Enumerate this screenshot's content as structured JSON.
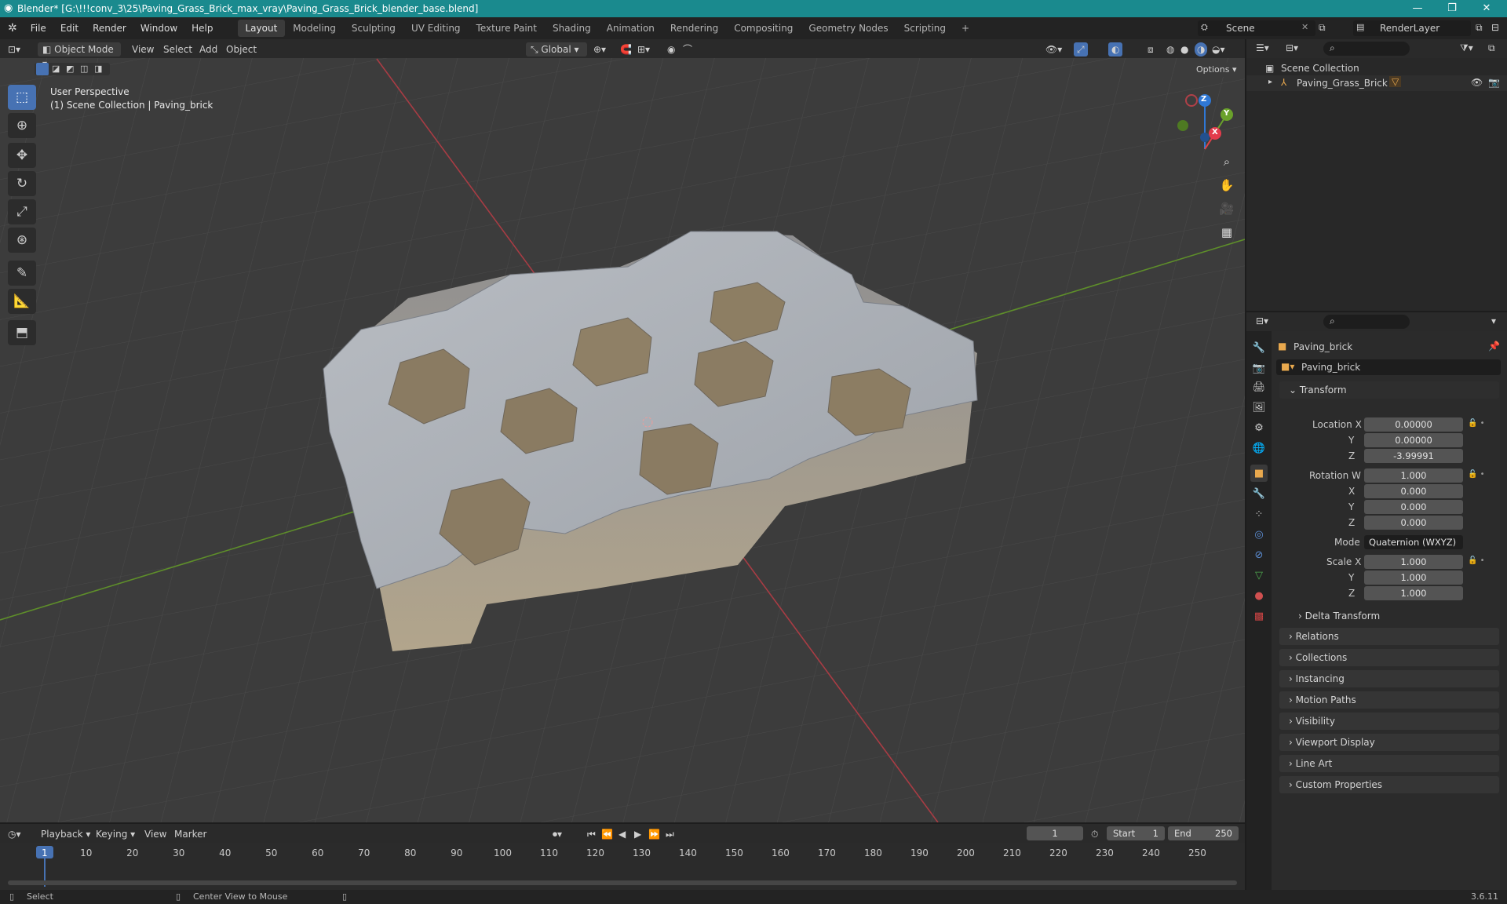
{
  "window": {
    "title": "Blender* [G:\\!!!conv_3\\25\\Paving_Grass_Brick_max_vray\\Paving_Grass_Brick_blender_base.blend]",
    "minimize": "—",
    "maximize": "❐",
    "close": "✕"
  },
  "menu": [
    "File",
    "Edit",
    "Render",
    "Window",
    "Help"
  ],
  "workspaces": [
    "Layout",
    "Modeling",
    "Sculpting",
    "UV Editing",
    "Texture Paint",
    "Shading",
    "Animation",
    "Rendering",
    "Compositing",
    "Geometry Nodes",
    "Scripting",
    "+"
  ],
  "active_workspace": "Layout",
  "scene_name": "Scene",
  "render_layer": "RenderLayer",
  "viewport_header": {
    "mode": "Object Mode",
    "menus": [
      "View",
      "Select",
      "Add",
      "Object"
    ],
    "orientation": "Global",
    "options": "Options"
  },
  "viewport": {
    "perspective": "User Perspective",
    "collection_info": "(1) Scene Collection | Paving_brick"
  },
  "gizmo": {
    "x": "X",
    "y": "Y",
    "z": "Z"
  },
  "outliner": {
    "root": "Scene Collection",
    "items": [
      {
        "label": "Paving_Grass_Brick"
      }
    ]
  },
  "properties": {
    "object_name": "Paving_brick",
    "data_name": "Paving_brick",
    "transform_label": "Transform",
    "location": {
      "label": "Location X",
      "x": "0.00000",
      "y": "0.00000",
      "z": "-3.99991"
    },
    "rotation": {
      "label": "Rotation W",
      "w": "1.000",
      "x": "0.000",
      "y": "0.000",
      "z": "0.000"
    },
    "mode_label": "Mode",
    "mode_value": "Quaternion (WXYZ)",
    "scale": {
      "label": "Scale X",
      "x": "1.000",
      "y": "1.000",
      "z": "1.000"
    },
    "axis_labels": [
      "Y",
      "Z",
      "X",
      "Y",
      "Z",
      "Y",
      "Z"
    ],
    "sections": [
      "Delta Transform",
      "Relations",
      "Collections",
      "Instancing",
      "Motion Paths",
      "Visibility",
      "Viewport Display",
      "Line Art",
      "Custom Properties"
    ]
  },
  "timeline": {
    "menus": [
      "Playback",
      "Keying",
      "View",
      "Marker"
    ],
    "current_frame": "1",
    "start_label": "Start",
    "start": "1",
    "end_label": "End",
    "end": "250",
    "ticks": [
      "1",
      "10",
      "20",
      "30",
      "40",
      "50",
      "60",
      "70",
      "80",
      "90",
      "100",
      "110",
      "120",
      "130",
      "140",
      "150",
      "160",
      "170",
      "180",
      "190",
      "200",
      "210",
      "220",
      "230",
      "240",
      "250"
    ]
  },
  "status": {
    "select": "Select",
    "center": "Center View to Mouse",
    "version": "3.6.11"
  },
  "colors": {
    "titlebar": "#1a8a8e",
    "accent": "#4772b3",
    "x_axis": "#e33b4b",
    "y_axis": "#6aa12b",
    "z_axis": "#2f78d6"
  }
}
